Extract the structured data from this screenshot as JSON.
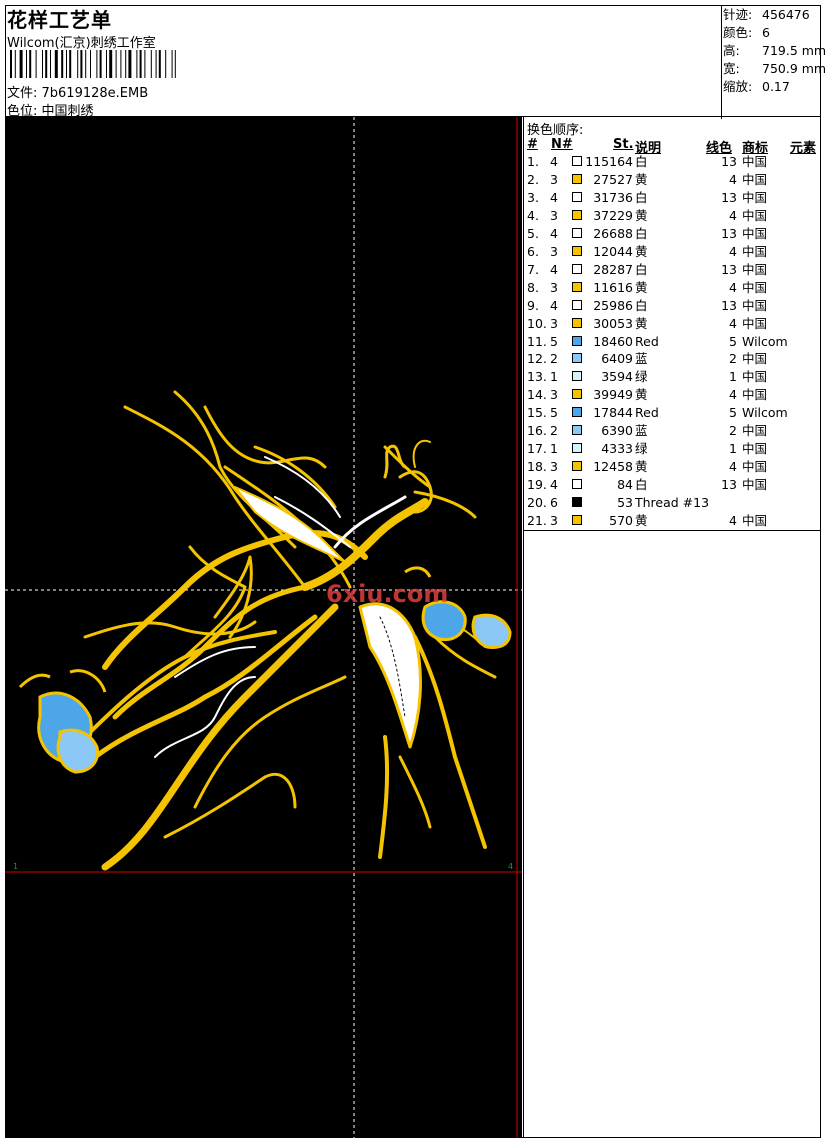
{
  "header": {
    "title": "花样工艺单",
    "subtitle": "Wilcom(汇京)刺绣工作室",
    "file": "文件: 7b619128e.EMB",
    "color_position": "色位: 中国刺绣"
  },
  "stats": [
    {
      "label": "针迹:",
      "value": "456476"
    },
    {
      "label": "颜色:",
      "value": "6"
    },
    {
      "label": "高:",
      "value": "719.5 mm"
    },
    {
      "label": "宽:",
      "value": "750.9 mm"
    },
    {
      "label": "缩放:",
      "value": "0.17"
    }
  ],
  "sequence": {
    "title": "换色顺序:",
    "headers": {
      "num": "#",
      "needle": "N#",
      "stitches": "St.",
      "desc": "说明",
      "thread": "线色",
      "brand": "商标",
      "element": "元素"
    },
    "rows": [
      {
        "n": "1.",
        "needle": "4",
        "color": "#ffffff",
        "st": "115164",
        "desc": "白",
        "thread": "13",
        "brand": "中国"
      },
      {
        "n": "2.",
        "needle": "3",
        "color": "#f5c400",
        "st": "27527",
        "desc": "黄",
        "thread": "4",
        "brand": "中国"
      },
      {
        "n": "3.",
        "needle": "4",
        "color": "#ffffff",
        "st": "31736",
        "desc": "白",
        "thread": "13",
        "brand": "中国"
      },
      {
        "n": "4.",
        "needle": "3",
        "color": "#f5c400",
        "st": "37229",
        "desc": "黄",
        "thread": "4",
        "brand": "中国"
      },
      {
        "n": "5.",
        "needle": "4",
        "color": "#ffffff",
        "st": "26688",
        "desc": "白",
        "thread": "13",
        "brand": "中国"
      },
      {
        "n": "6.",
        "needle": "3",
        "color": "#f5c400",
        "st": "12044",
        "desc": "黄",
        "thread": "4",
        "brand": "中国"
      },
      {
        "n": "7.",
        "needle": "4",
        "color": "#ffffff",
        "st": "28287",
        "desc": "白",
        "thread": "13",
        "brand": "中国"
      },
      {
        "n": "8.",
        "needle": "3",
        "color": "#f5c400",
        "st": "11616",
        "desc": "黄",
        "thread": "4",
        "brand": "中国"
      },
      {
        "n": "9.",
        "needle": "4",
        "color": "#ffffff",
        "st": "25986",
        "desc": "白",
        "thread": "13",
        "brand": "中国"
      },
      {
        "n": "10.",
        "needle": "3",
        "color": "#f5c400",
        "st": "30053",
        "desc": "黄",
        "thread": "4",
        "brand": "中国"
      },
      {
        "n": "11.",
        "needle": "5",
        "color": "#4da6e8",
        "st": "18460",
        "desc": "Red",
        "thread": "5",
        "brand": "Wilcom"
      },
      {
        "n": "12.",
        "needle": "2",
        "color": "#8cc8f5",
        "st": "6409",
        "desc": "蓝",
        "thread": "2",
        "brand": "中国"
      },
      {
        "n": "13.",
        "needle": "1",
        "color": "#d4f4f8",
        "st": "3594",
        "desc": "绿",
        "thread": "1",
        "brand": "中国"
      },
      {
        "n": "14.",
        "needle": "3",
        "color": "#f5c400",
        "st": "39949",
        "desc": "黄",
        "thread": "4",
        "brand": "中国"
      },
      {
        "n": "15.",
        "needle": "5",
        "color": "#4da6e8",
        "st": "17844",
        "desc": "Red",
        "thread": "5",
        "brand": "Wilcom"
      },
      {
        "n": "16.",
        "needle": "2",
        "color": "#8cc8f5",
        "st": "6390",
        "desc": "蓝",
        "thread": "2",
        "brand": "中国"
      },
      {
        "n": "17.",
        "needle": "1",
        "color": "#d4f4f8",
        "st": "4333",
        "desc": "绿",
        "thread": "1",
        "brand": "中国"
      },
      {
        "n": "18.",
        "needle": "3",
        "color": "#f5c400",
        "st": "12458",
        "desc": "黄",
        "thread": "4",
        "brand": "中国"
      },
      {
        "n": "19.",
        "needle": "4",
        "color": "#ffffff",
        "st": "84",
        "desc": "白",
        "thread": "13",
        "brand": "中国"
      },
      {
        "n": "20.",
        "needle": "6",
        "color": "#000000",
        "st": "53",
        "desc": "Thread #13",
        "thread": "",
        "brand": ""
      },
      {
        "n": "21.",
        "needle": "3",
        "color": "#f5c400",
        "st": "570",
        "desc": "黄",
        "thread": "4",
        "brand": "中国"
      }
    ]
  },
  "canvas": {
    "watermark": "6xiu.com",
    "corner_left": "1",
    "corner_right": "4",
    "colors": {
      "gold": "#f5c400",
      "white": "#ffffff",
      "blue": "#4da6e8",
      "lightblue": "#8cc8f5",
      "guide": "#d00000"
    }
  }
}
